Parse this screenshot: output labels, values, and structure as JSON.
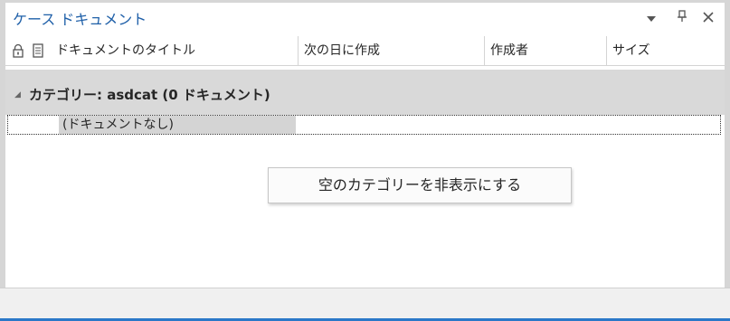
{
  "panel": {
    "title": "ケース ドキュメント",
    "controls": {
      "dropdown_icon": "triangle-down",
      "pin_icon": "pin",
      "close_icon": "close-x"
    }
  },
  "columns": {
    "lock_icon": "lock",
    "document_icon": "document",
    "title": "ドキュメントのタイトル",
    "next_day_created": "次の日に作成",
    "author": "作成者",
    "size": "サイズ"
  },
  "group": {
    "label": "カテゴリー: asdcat (0 ドキュメント)",
    "expand_icon": "triangle-collapse"
  },
  "empty_row": {
    "text": "(ドキュメントなし)"
  },
  "context_menu": {
    "item": "空のカテゴリーを非表示にする"
  },
  "colors": {
    "title": "#1e5fa8",
    "group_background": "#d9d9d9",
    "accent": "#2b78c8"
  }
}
